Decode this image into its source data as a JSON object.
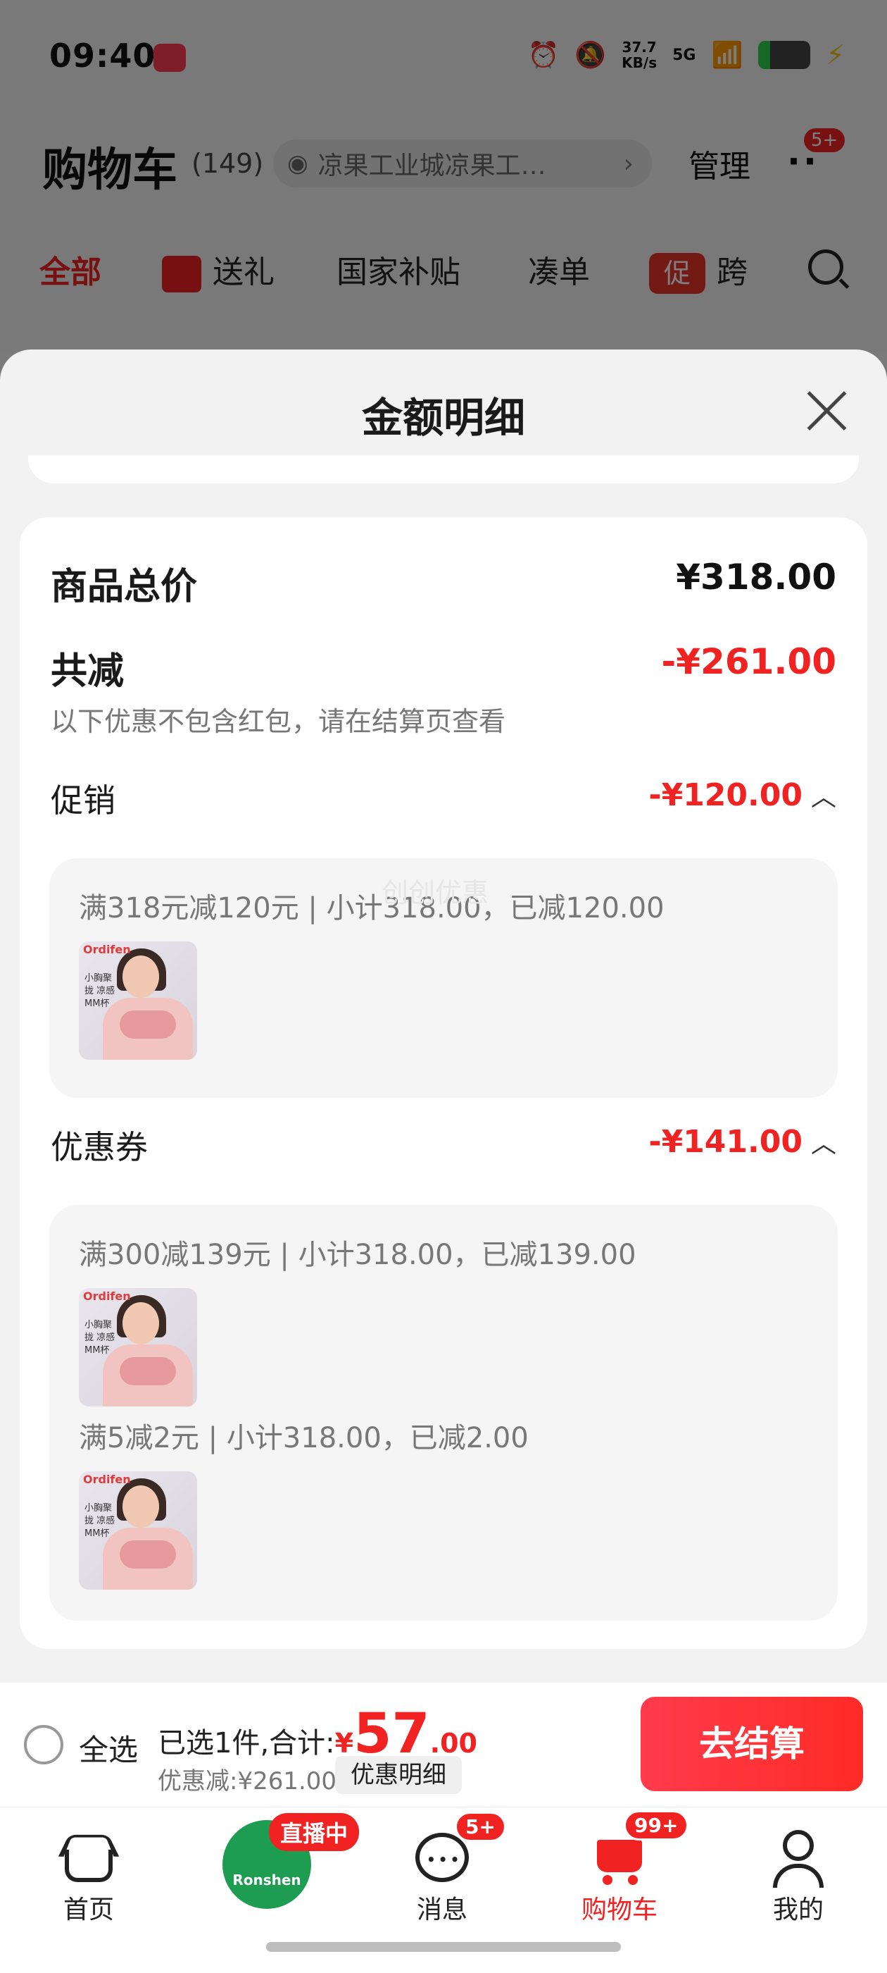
{
  "status_bar": {
    "time": "09:40",
    "speed_value": "37.7",
    "speed_unit": "KB/s",
    "network": "5G"
  },
  "header": {
    "title": "购物车",
    "count": "(149)",
    "location": "凉果工业城凉果工…",
    "manage": "管理",
    "more_badge": "5+"
  },
  "tabs": [
    "全部",
    "送礼",
    "国家补贴",
    "凑单",
    "跨"
  ],
  "tab_promo_icon": "促",
  "sheet": {
    "title": "金额明细",
    "total_label": "商品总价",
    "total_value": "¥318.00",
    "reduce_label": "共减",
    "reduce_value": "-¥261.00",
    "note": "以下优惠不包含红包，请在结算页查看",
    "promo": {
      "label": "促销",
      "value": "-¥120.00",
      "detail": "满318元减120元 | 小计318.00，已减120.00"
    },
    "coupon": {
      "label": "优惠券",
      "value": "-¥141.00",
      "detail1": "满300减139元 | 小计318.00，已减139.00",
      "detail2": "满5减2元 | 小计318.00，已减2.00"
    },
    "product_brand": "Ordifen",
    "product_caption": "小胸聚拢 凉感MM杯",
    "watermark": "创创优惠"
  },
  "checkout": {
    "select_all": "全选",
    "selected_prefix": "已选1件,合计:",
    "currency": "¥",
    "amount_int": "57",
    "amount_dec": ".00",
    "discount": "优惠减:¥261.00",
    "discount_btn": "优惠明细",
    "checkout_btn": "去结算"
  },
  "bottom_nav": {
    "home": "首页",
    "live_badge": "直播中",
    "live_brand": "Ronshen",
    "messages": "消息",
    "messages_badge": "5+",
    "cart": "购物车",
    "cart_badge": "99+",
    "mine": "我的"
  },
  "colors": {
    "accent_red": "#f02222",
    "sheet_bg": "#f2f2f2"
  }
}
